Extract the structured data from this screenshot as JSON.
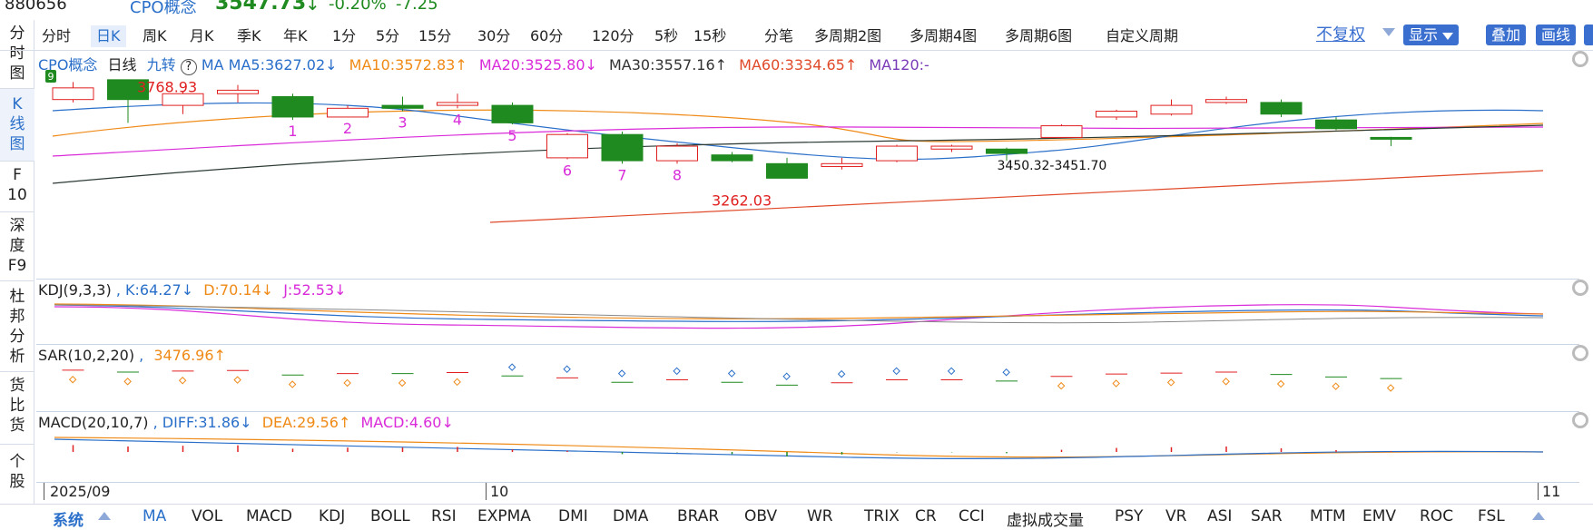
{
  "header": {
    "code": "880656",
    "name": "CPO概念",
    "price": "3547.73",
    "arrow": "↓",
    "pct": "-0.20%",
    "change": "-7.25"
  },
  "vertical_tabs": [
    {
      "label": "分\n时\n图"
    },
    {
      "label": "K\n线\n图"
    },
    {
      "label": "F\n10"
    },
    {
      "label": "深\n度\nF9"
    },
    {
      "label": "杜\n邦\n分\n析"
    },
    {
      "label": "货\n比\n货"
    },
    {
      "label": "个\n股"
    }
  ],
  "period_tabs": [
    "分时",
    "日K",
    "周K",
    "月K",
    "季K",
    "年K",
    "1分",
    "5分",
    "15分",
    "30分",
    "60分",
    "120分",
    "5秒",
    "15秒",
    "分笔",
    "多周期2图",
    "多周期4图",
    "多周期6图",
    "自定义周期"
  ],
  "toolbar": {
    "fq": "不复权",
    "show": "显示",
    "overlay": "叠加",
    "line": "画线"
  },
  "main_legend": {
    "name": "CPO概念",
    "period": "日线",
    "jiuzhuan": "九转",
    "ma": "MA",
    "ma5": "MA5:3627.02↓",
    "ma10": "MA10:3572.83↑",
    "ma20": "MA20:3525.80↓",
    "ma30": "MA30:3557.16↑",
    "ma60": "MA60:3334.65↑",
    "ma120": "MA120:-"
  },
  "annotations": {
    "high": "3768.93",
    "low": "3262.03",
    "range": "3450.32-3451.70",
    "badge": "9"
  },
  "kdj": {
    "label": "KDJ(9,3,3)",
    "k": ", K:64.27↓",
    "d": "D:70.14↓",
    "j": "J:52.53↓"
  },
  "sar": {
    "label": "SAR(10,2,20)",
    "v": ",",
    "val": "3476.96↑"
  },
  "macd": {
    "label": "MACD(20,10,7)",
    "diff": ", DIFF:31.86↓",
    "dea": "DEA:29.56↑",
    "macd": "MACD:4.60↓"
  },
  "x_axis": [
    "2025/09",
    "10",
    "11"
  ],
  "bottom_tabs": [
    "系统",
    "MA",
    "VOL",
    "MACD",
    "KDJ",
    "BOLL",
    "RSI",
    "EXPMA",
    "DMI",
    "DMA",
    "BRAR",
    "OBV",
    "WR",
    "TRIX",
    "CR",
    "CCI",
    "虚拟成交量",
    "PSY",
    "VR",
    "ASI",
    "SAR",
    "MTM",
    "EMV",
    "ROC",
    "FSL"
  ],
  "colors": {
    "up": "#e02020",
    "down": "#1f8a1f",
    "blue": "#2a6fc9",
    "orange": "#ef8a17",
    "magenta": "#d92bd9"
  },
  "chart_data": {
    "type": "candlestick",
    "candles": [
      {
        "o": 3700,
        "c": 3740,
        "h": 3760,
        "l": 3690
      },
      {
        "o": 3768,
        "c": 3700,
        "h": 3769,
        "l": 3620
      },
      {
        "o": 3680,
        "c": 3720,
        "h": 3730,
        "l": 3650
      },
      {
        "o": 3720,
        "c": 3732,
        "h": 3750,
        "l": 3690
      },
      {
        "o": 3710,
        "c": 3640,
        "h": 3720,
        "l": 3630
      },
      {
        "o": 3640,
        "c": 3670,
        "h": 3680,
        "l": 3640
      },
      {
        "o": 3680,
        "c": 3670,
        "h": 3710,
        "l": 3660
      },
      {
        "o": 3680,
        "c": 3690,
        "h": 3720,
        "l": 3670
      },
      {
        "o": 3680,
        "c": 3620,
        "h": 3690,
        "l": 3615
      },
      {
        "o": 3500,
        "c": 3580,
        "h": 3585,
        "l": 3495
      },
      {
        "o": 3580,
        "c": 3490,
        "h": 3590,
        "l": 3480
      },
      {
        "o": 3490,
        "c": 3540,
        "h": 3550,
        "l": 3480
      },
      {
        "o": 3510,
        "c": 3490,
        "h": 3520,
        "l": 3485
      },
      {
        "o": 3480,
        "c": 3430,
        "h": 3500,
        "l": 3430
      },
      {
        "o": 3470,
        "c": 3480,
        "h": 3500,
        "l": 3460
      },
      {
        "o": 3490,
        "c": 3540,
        "h": 3545,
        "l": 3485
      },
      {
        "o": 3530,
        "c": 3540,
        "h": 3545,
        "l": 3520
      },
      {
        "o": 3530,
        "c": 3515,
        "h": 3535,
        "l": 3490
      },
      {
        "o": 3570,
        "c": 3610,
        "h": 3615,
        "l": 3568
      },
      {
        "o": 3640,
        "c": 3660,
        "h": 3665,
        "l": 3630
      },
      {
        "o": 3650,
        "c": 3680,
        "h": 3700,
        "l": 3645
      },
      {
        "o": 3690,
        "c": 3700,
        "h": 3710,
        "l": 3685
      },
      {
        "o": 3690,
        "c": 3650,
        "h": 3700,
        "l": 3640
      },
      {
        "o": 3630,
        "c": 3600,
        "h": 3640,
        "l": 3595
      },
      {
        "o": 3570,
        "c": 3567,
        "h": 3572,
        "l": 3540
      }
    ],
    "nine_labels": [
      {
        "i": 4,
        "t": "1"
      },
      {
        "i": 5,
        "t": "2"
      },
      {
        "i": 6,
        "t": "3"
      },
      {
        "i": 7,
        "t": "4"
      },
      {
        "i": 8,
        "t": "5"
      },
      {
        "i": 9,
        "t": "6"
      },
      {
        "i": 10,
        "t": "7"
      },
      {
        "i": 11,
        "t": "8"
      }
    ]
  }
}
